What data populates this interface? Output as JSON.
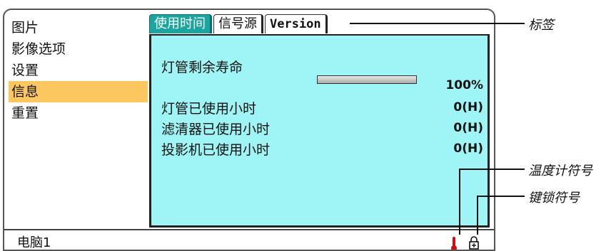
{
  "menu": {
    "items": [
      {
        "label": "图片"
      },
      {
        "label": "影像选项"
      },
      {
        "label": "设置"
      },
      {
        "label": "信息"
      },
      {
        "label": "重置"
      }
    ],
    "active_index": 3
  },
  "tabs": [
    {
      "label": "使用时间",
      "active": true
    },
    {
      "label": "信号源",
      "active": false
    },
    {
      "label": "Version",
      "active": false
    }
  ],
  "panel": {
    "lamp_remaining_label": "灯管剩余寿命",
    "lamp_remaining_value": "100%",
    "lamp_remaining_fraction": 1.0,
    "lamp_hours_label": "灯管已使用小时",
    "lamp_hours_value": "0(H)",
    "filter_hours_label": "滤清器已使用小时",
    "filter_hours_value": "0(H)",
    "projector_hours_label": "投影机已使用小时",
    "projector_hours_value": "0(H)"
  },
  "status": {
    "source": "电脑1",
    "icons": [
      "thermometer-icon",
      "key-lock-icon"
    ]
  },
  "callouts": {
    "tab": "标签",
    "thermometer": "温度计符号",
    "lock": "键锁符号"
  },
  "colors": {
    "panel_bg": "#9ff5f5",
    "active_tab": "#1aa5a1",
    "active_menu": "#fcc75f",
    "thermometer": "#cc1111"
  }
}
